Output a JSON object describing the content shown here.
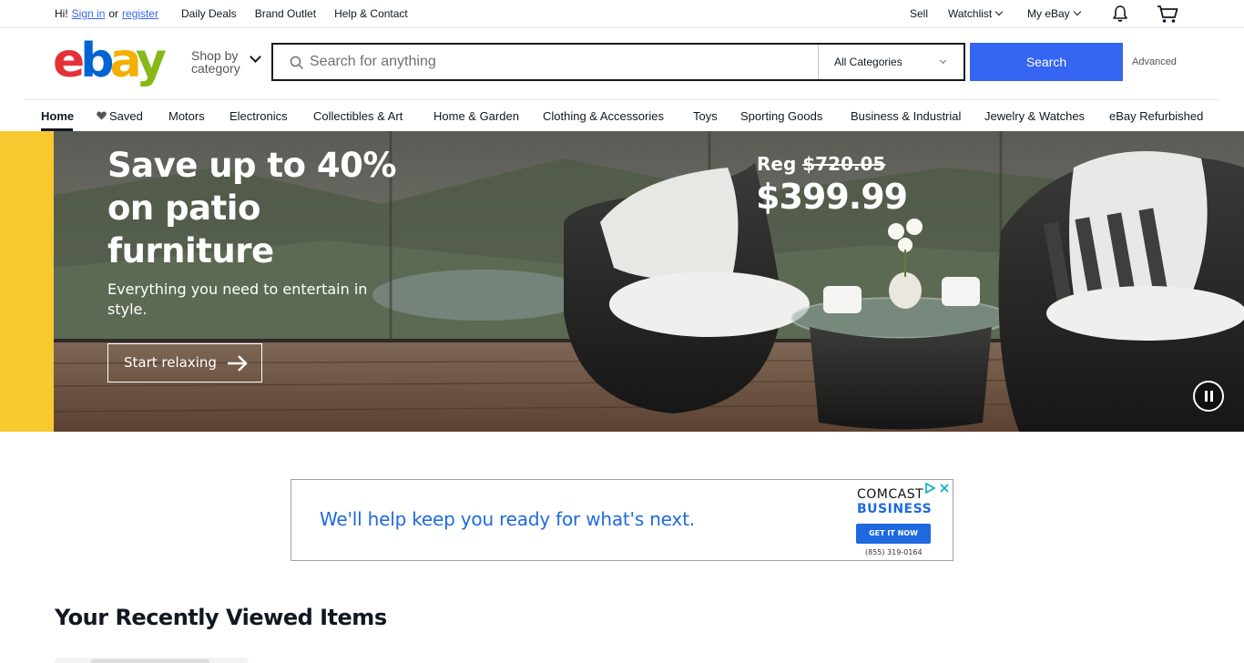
{
  "topbar": {
    "greeting": "Hi!",
    "sign_in": "Sign in",
    "or": "or",
    "register": "register",
    "links": [
      "Daily Deals",
      "Brand Outlet",
      "Help & Contact"
    ],
    "sell": "Sell",
    "watchlist": "Watchlist",
    "my_ebay": "My eBay",
    "notification_icon": "bell-icon",
    "cart_icon": "cart-icon"
  },
  "header": {
    "logo_letters": [
      "e",
      "b",
      "a",
      "y"
    ],
    "logo_colors": [
      "#e53238",
      "#0064d2",
      "#f5af02",
      "#86b817"
    ],
    "shop_by_line1": "Shop by",
    "shop_by_line2": "category",
    "search_placeholder": "Search for anything",
    "search_value": "",
    "category_selected": "All Categories",
    "search_button": "Search",
    "advanced": "Advanced",
    "accent": "#3665f3"
  },
  "catnav": {
    "items": [
      "Home",
      "Saved",
      "Motors",
      "Electronics",
      "Collectibles & Art",
      "Home & Garden",
      "Clothing & Accessories",
      "Toys",
      "Sporting Goods",
      "Business & Industrial",
      "Jewelry & Watches",
      "eBay Refurbished"
    ],
    "active": "Home"
  },
  "hero": {
    "title": "Save up to 40% on patio furniture",
    "subtitle": "Everything you need to entertain in style.",
    "cta": "Start relaxing",
    "price_reg_label": "Reg",
    "price_reg": "$720.05",
    "price_now": "$399.99",
    "accent": "#f7c92f"
  },
  "ad": {
    "text": "We'll help keep you ready for what's next.",
    "brand_line1": "COMCAST",
    "brand_line2": "BUSINESS",
    "cta": "GET IT NOW",
    "phone": "(855) 319-0164"
  },
  "recently_viewed": {
    "title": "Your Recently Viewed Items"
  }
}
